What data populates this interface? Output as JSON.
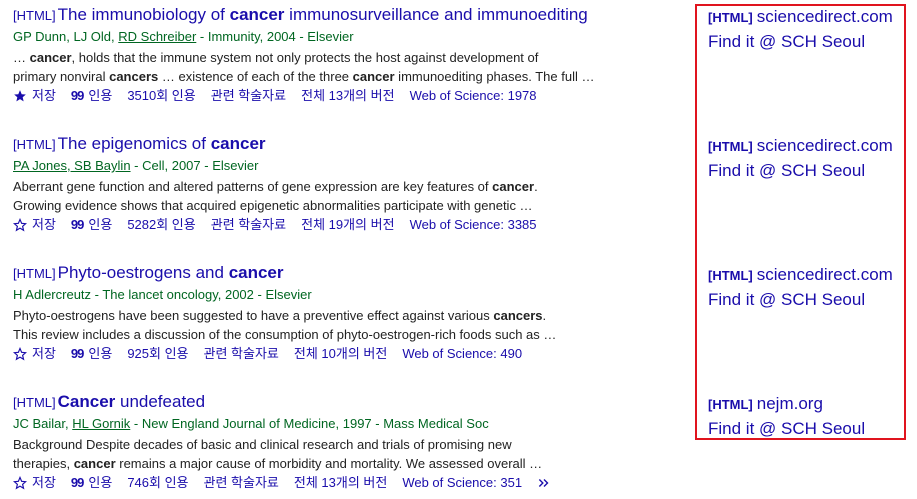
{
  "results": [
    {
      "tag": "[HTML]",
      "title_pre": "The immunobiology of ",
      "title_bold": "cancer",
      "title_post": " immunosurveillance and immunoediting",
      "authors_plain": "GP Dunn, LJ Old, ",
      "authors_link": "RD Schreiber",
      "source": " - Immunity, 2004 - Elsevier",
      "snippet1_a": "… ",
      "snippet1_b": "cancer",
      "snippet1_c": ", holds that the immune system not only protects the host against development of",
      "snippet2_a": "primary nonviral ",
      "snippet2_b": "cancers",
      "snippet2_c": " … existence of each of the three ",
      "snippet2_d": "cancer",
      "snippet2_e": " immunoediting phases. The full …",
      "save": "저장",
      "cite": "인용",
      "cited_by": "3510회 인용",
      "related": "관련 학술자료",
      "versions": "전체 13개의 버전",
      "wos": "Web of Science: 1978",
      "saved": true
    },
    {
      "tag": "[HTML]",
      "title_pre": "The epigenomics of ",
      "title_bold": "cancer",
      "title_post": "",
      "authors_plain": "",
      "authors_link": "PA Jones, SB Baylin",
      "source": " - Cell, 2007 - Elsevier",
      "snippet1_a": "Aberrant gene function and altered patterns of gene expression are key features of ",
      "snippet1_b": "cancer",
      "snippet1_c": ".",
      "snippet2_a": "Growing evidence shows that acquired epigenetic abnormalities participate with genetic …",
      "snippet2_b": "",
      "snippet2_c": "",
      "snippet2_d": "",
      "snippet2_e": "",
      "save": "저장",
      "cite": "인용",
      "cited_by": "5282회 인용",
      "related": "관련 학술자료",
      "versions": "전체 19개의 버전",
      "wos": "Web of Science: 3385",
      "saved": false
    },
    {
      "tag": "[HTML]",
      "title_pre": "Phyto-oestrogens and ",
      "title_bold": "cancer",
      "title_post": "",
      "authors_plain": "H Adlercreutz",
      "authors_link": "",
      "source": " - The lancet oncology, 2002 - Elsevier",
      "snippet1_a": "Phyto-oestrogens have been suggested to have a preventive effect against various ",
      "snippet1_b": "cancers",
      "snippet1_c": ".",
      "snippet2_a": "This review includes a discussion of the consumption of phyto-oestrogen-rich foods such as …",
      "snippet2_b": "",
      "snippet2_c": "",
      "snippet2_d": "",
      "snippet2_e": "",
      "save": "저장",
      "cite": "인용",
      "cited_by": "925회 인용",
      "related": "관련 학술자료",
      "versions": "전체 10개의 버전",
      "wos": "Web of Science: 490",
      "saved": false
    },
    {
      "tag": "[HTML]",
      "title_pre": "",
      "title_bold": "Cancer",
      "title_post": " undefeated",
      "authors_plain": "JC Bailar, ",
      "authors_link": "HL Gornik",
      "source": " - New England Journal of Medicine, 1997 - Mass Medical Soc",
      "snippet1_a": "Background Despite decades of basic and clinical research and trials of promising new",
      "snippet1_b": "",
      "snippet1_c": "",
      "snippet2_a": "therapies, ",
      "snippet2_b": "cancer",
      "snippet2_c": " remains a major cause of morbidity and mortality. We assessed overall …",
      "snippet2_d": "",
      "snippet2_e": "",
      "save": "저장",
      "cite": "인용",
      "cited_by": "746회 인용",
      "related": "관련 학술자료",
      "versions": "전체 13개의 버전",
      "wos": "Web of Science: 351",
      "saved": false
    }
  ],
  "sidebar": [
    {
      "tag": "[HTML]",
      "link": "sciencedirect.com",
      "find": "Find it @ SCH Seoul"
    },
    {
      "tag": "[HTML]",
      "link": "sciencedirect.com",
      "find": "Find it @ SCH Seoul"
    },
    {
      "tag": "[HTML]",
      "link": "sciencedirect.com",
      "find": "Find it @ SCH Seoul"
    },
    {
      "tag": "[HTML]",
      "link": "nejm.org",
      "find": "Find it @ SCH Seoul"
    }
  ],
  "colors": {
    "link": "#1a0dab",
    "meta": "#006621",
    "highlight_box": "#e0141e"
  }
}
